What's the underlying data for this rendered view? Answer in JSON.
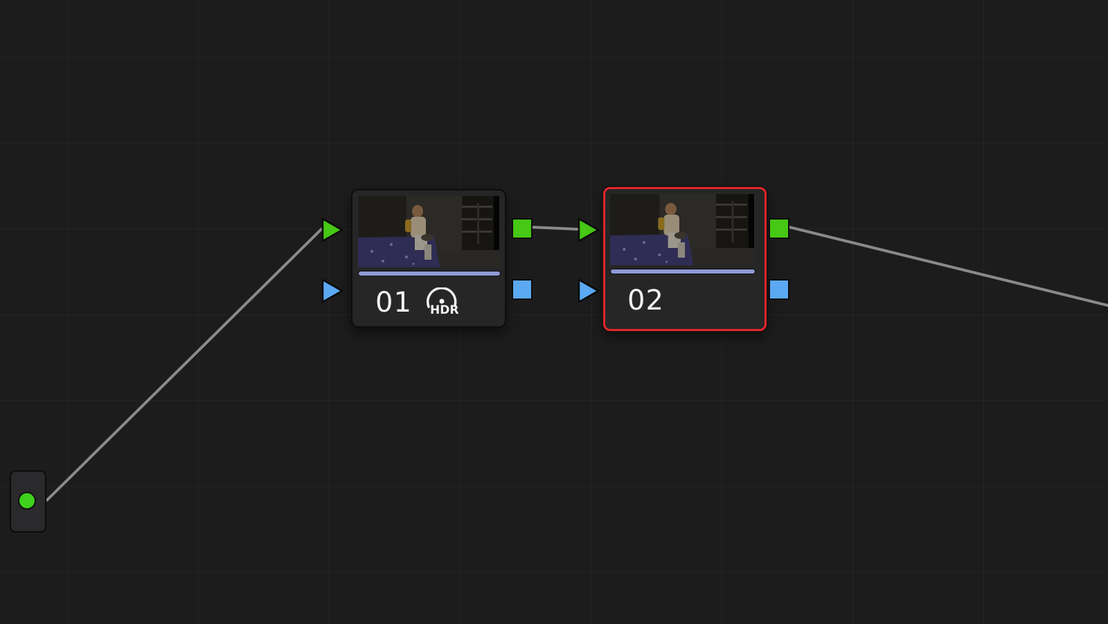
{
  "node_editor": {
    "background_color": "#1c1c1c",
    "connection_color": "#8a8a8a",
    "input_node": {
      "icon": "green-dot-icon",
      "color": "#3fd01e"
    },
    "nodes": [
      {
        "label": "01",
        "selected": false,
        "badge": {
          "icon": "hdr-icon",
          "text": "HDR"
        },
        "progress_bar_color": "#8e9ad6"
      },
      {
        "label": "02",
        "selected": true,
        "selection_color": "#e6262b",
        "progress_bar_color": "#8e9ad6"
      }
    ],
    "ports": {
      "rgb_color": "#46c814",
      "key_color": "#5ba9f2"
    }
  }
}
